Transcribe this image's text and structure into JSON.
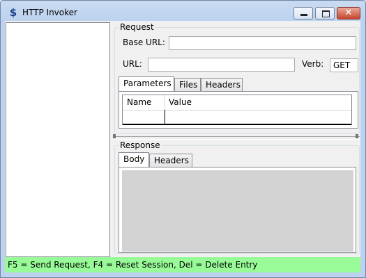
{
  "window": {
    "title": "HTTP Invoker",
    "close_glyph": "✕"
  },
  "request": {
    "group_label": "Request",
    "base_url_label": "Base URL:",
    "base_url_value": "",
    "url_label": "URL:",
    "url_value": "",
    "verb_label": "Verb:",
    "verb_value": "GET",
    "tabs": [
      {
        "label": "Parameters",
        "active": true
      },
      {
        "label": "Files",
        "active": false
      },
      {
        "label": "Headers",
        "active": false
      }
    ],
    "grid": {
      "columns": [
        "Name",
        "Value"
      ]
    }
  },
  "response": {
    "group_label": "Response",
    "tabs": [
      {
        "label": "Body",
        "active": true
      },
      {
        "label": "Headers",
        "active": false
      }
    ]
  },
  "status": {
    "text": "F5 = Send Request, F4 = Reset Session, Del = Delete Entry"
  }
}
